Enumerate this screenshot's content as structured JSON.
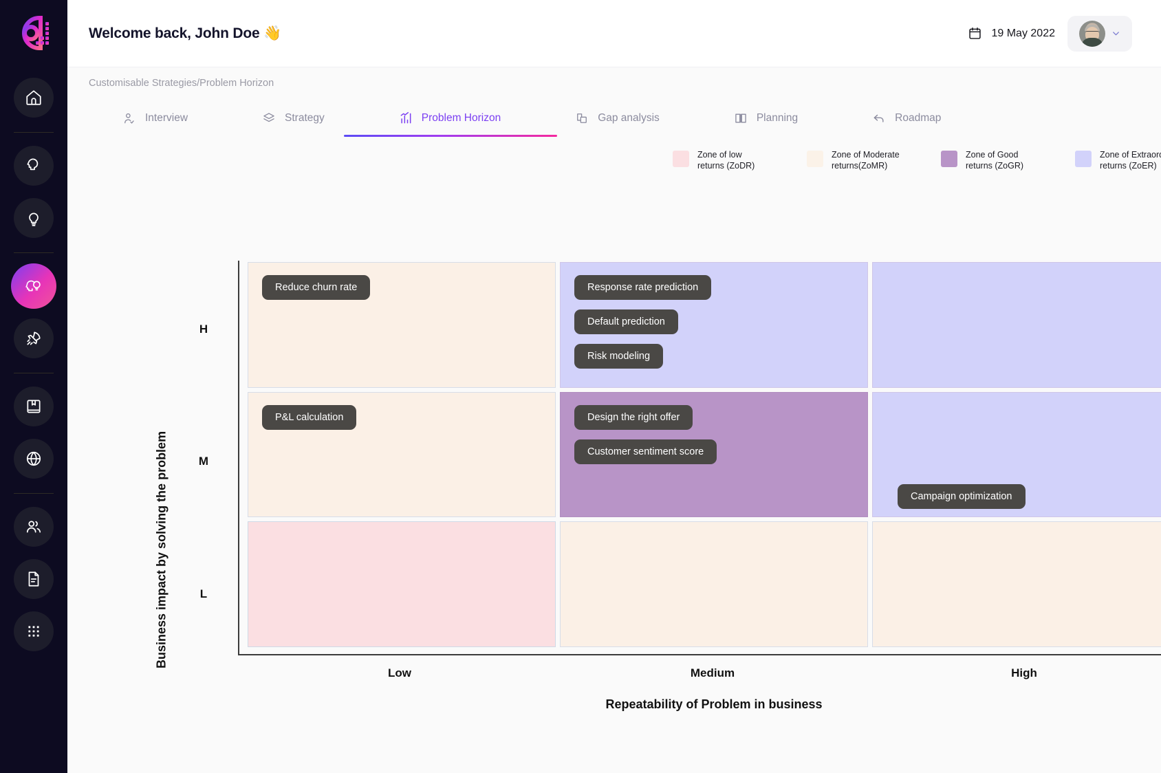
{
  "sidebar": {
    "logo_name": "brand-logo",
    "items": [
      {
        "id": "home",
        "icon": "home-icon",
        "label": "Home",
        "active": false
      },
      {
        "id": "interview",
        "icon": "head-profile-icon",
        "label": "Interview",
        "active": false
      },
      {
        "id": "ideas",
        "icon": "lightbulb-icon",
        "label": "Ideas",
        "active": false
      },
      {
        "id": "strategies",
        "icon": "head-bulb-icon",
        "label": "Customisable Strategies",
        "active": true
      },
      {
        "id": "launch",
        "icon": "rocket-icon",
        "label": "Launch",
        "active": false
      },
      {
        "id": "library",
        "icon": "book-icon",
        "label": "Library",
        "active": false
      },
      {
        "id": "global",
        "icon": "globe-icon",
        "label": "Global",
        "active": false
      },
      {
        "id": "team",
        "icon": "users-icon",
        "label": "Team",
        "active": false
      },
      {
        "id": "documents",
        "icon": "document-icon",
        "label": "Documents",
        "active": false
      },
      {
        "id": "apps",
        "icon": "grid-dots-icon",
        "label": "Apps",
        "active": false
      }
    ]
  },
  "header": {
    "welcome": "Welcome back, John Doe 👋",
    "date": "19 May 2022",
    "date_icon": "calendar-icon",
    "avatar_chevron_icon": "chevron-down-icon",
    "breadcrumb": "Customisable Strategies/Problem Horizon"
  },
  "tabs": [
    {
      "label": "Interview",
      "icon": "user-check-icon",
      "active": false
    },
    {
      "label": "Strategy",
      "icon": "layers-icon",
      "active": false
    },
    {
      "label": "Problem Horizon",
      "icon": "bar-chart-icon",
      "active": true
    },
    {
      "label": "Gap analysis",
      "icon": "frame-icon",
      "active": false
    },
    {
      "label": "Planning",
      "icon": "book-open-icon",
      "active": false
    },
    {
      "label": "Roadmap",
      "icon": "arrow-back-icon",
      "active": false
    }
  ],
  "legend": [
    {
      "label": "Zone of low\nreturns (ZoDR)",
      "line1": "Zone of low",
      "line2": "returns (ZoDR)",
      "color": "#fbdfe2"
    },
    {
      "label": "Zone of Moderate\nreturns(ZoMR)",
      "line1": "Zone of Moderate",
      "line2": "returns(ZoMR)",
      "color": "#fbf2e8"
    },
    {
      "label": "Zone of Good\nreturns (ZoGR)",
      "line1": "Zone of Good",
      "line2": "returns (ZoGR)",
      "color": "#b894c7"
    },
    {
      "label": "Zone of Extraordinary\nreturns (ZoER)",
      "line1": "Zone of Extraordinary",
      "line2": "returns (ZoER)",
      "color": "#d2d2fa"
    }
  ],
  "chart_data": {
    "type": "heatmap",
    "title": "Problem Horizon",
    "xlabel": "Repeatability of Problem in business",
    "ylabel": "Business impact by solving the problem",
    "x_categories": [
      "Low",
      "Medium",
      "High"
    ],
    "y_categories": [
      "H",
      "M",
      "L"
    ],
    "y_ticks_top_to_bottom": [
      "H",
      "M",
      "L"
    ],
    "zones": {
      "ZoDR": "#fbdfe2",
      "ZoMR": "#fbf0e6",
      "ZoGR": "#b894c7",
      "ZoER": "#d2d2fa"
    },
    "cells": [
      {
        "row": "H",
        "col": "Low",
        "zone": "ZoMR",
        "items": [
          "Reduce churn rate"
        ]
      },
      {
        "row": "H",
        "col": "Medium",
        "zone": "ZoER",
        "items": [
          "Response rate prediction",
          "Default prediction",
          "Risk modeling"
        ]
      },
      {
        "row": "H",
        "col": "High",
        "zone": "ZoER",
        "items": []
      },
      {
        "row": "M",
        "col": "Low",
        "zone": "ZoMR",
        "items": [
          "P&L calculation"
        ]
      },
      {
        "row": "M",
        "col": "Medium",
        "zone": "ZoGR",
        "items": [
          "Design the right offer",
          "Customer sentiment score"
        ]
      },
      {
        "row": "M",
        "col": "High",
        "zone": "ZoER",
        "items": [
          "Campaign optimization"
        ]
      },
      {
        "row": "L",
        "col": "Low",
        "zone": "ZoDR",
        "items": []
      },
      {
        "row": "L",
        "col": "Medium",
        "zone": "ZoMR",
        "items": []
      },
      {
        "row": "L",
        "col": "High",
        "zone": "ZoMR",
        "items": []
      }
    ]
  },
  "matrix": {
    "y_tick_h": "H",
    "y_tick_m": "M",
    "y_tick_l": "L",
    "x_tick_low": "Low",
    "x_tick_medium": "Medium",
    "x_tick_high": "High",
    "xlabel": "Repeatability of Problem in business",
    "ylabel": "Business impact by solving the problem",
    "pill_h_low_1": "Reduce churn rate",
    "pill_h_med_1": "Response rate prediction",
    "pill_h_med_2": "Default prediction",
    "pill_h_med_3": "Risk modeling",
    "pill_m_low_1": "P&L calculation",
    "pill_m_med_1": "Design the right offer",
    "pill_m_med_2": "Customer sentiment score",
    "pill_m_high_1": "Campaign optimization"
  },
  "theme": {
    "accent_start": "#5b4bf5",
    "accent_end": "#f5289e",
    "sidebar_bg": "#0d0b21",
    "active_tab": "#7b3ff2"
  }
}
